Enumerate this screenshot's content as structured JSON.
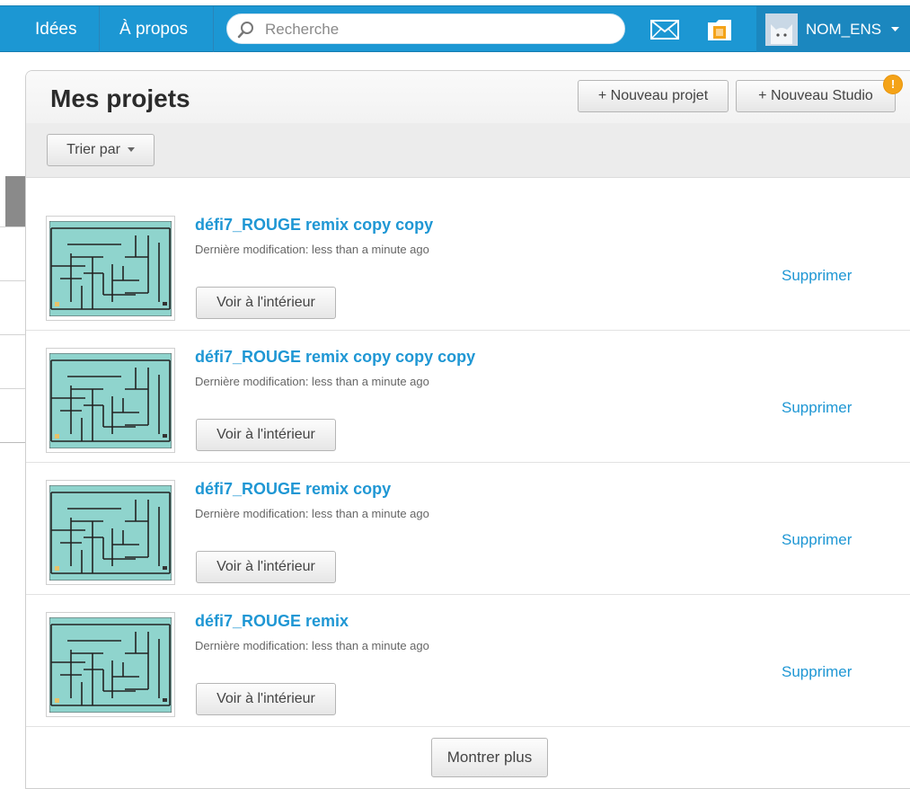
{
  "nav": {
    "ideas": "Idées",
    "about": "À propos",
    "search_placeholder": "Recherche",
    "account_name": "NOM_ENS"
  },
  "icons": {
    "messages": "envelope-icon",
    "backpack": "folder-icon",
    "avatar": "cat-avatar-icon",
    "search": "search-icon"
  },
  "colors": {
    "navbar": "#1c97d3",
    "link": "#1f97d4",
    "badge": "#f4a318",
    "thumbnail_bg": "#8fd4cd"
  },
  "page": {
    "title": "Mes projets",
    "new_project": "+ Nouveau projet",
    "new_studio": "+ Nouveau Studio",
    "badge": "!",
    "sort_label": "Trier par",
    "show_more": "Montrer plus"
  },
  "projects": [
    {
      "title": "défi7_ROUGE remix copy copy",
      "modified": "Dernière modification: less than a minute ago",
      "view_label": "Voir à l'intérieur",
      "delete_label": "Supprimer"
    },
    {
      "title": "défi7_ROUGE remix copy copy copy",
      "modified": "Dernière modification: less than a minute ago",
      "view_label": "Voir à l'intérieur",
      "delete_label": "Supprimer"
    },
    {
      "title": "défi7_ROUGE remix copy",
      "modified": "Dernière modification: less than a minute ago",
      "view_label": "Voir à l'intérieur",
      "delete_label": "Supprimer"
    },
    {
      "title": "défi7_ROUGE remix",
      "modified": "Dernière modification: less than a minute ago",
      "view_label": "Voir à l'intérieur",
      "delete_label": "Supprimer"
    }
  ]
}
